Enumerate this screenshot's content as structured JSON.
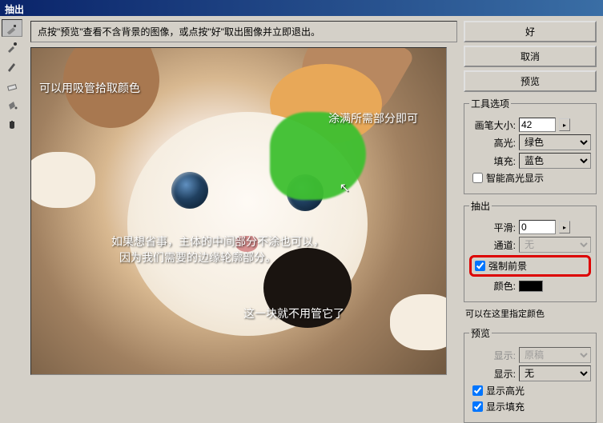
{
  "window": {
    "title": "抽出"
  },
  "hint": "点按\"预览\"查看不含背景的图像，或点按\"好\"取出图像并立即退出。",
  "overlay": {
    "text1": "可以用吸管拾取颜色",
    "text2": "涂满所需部分即可",
    "text3_line1": "如果想省事，主体的中间部分不涂也可以，",
    "text3_line2": "因为我们需要的边缘轮廓部分。",
    "text4": "这一块就不用管它了"
  },
  "buttons": {
    "ok": "好",
    "cancel": "取消",
    "preview": "预览"
  },
  "tool_options": {
    "legend": "工具选项",
    "brush_size_label": "画笔大小:",
    "brush_size_value": "42",
    "highlight_label": "高光:",
    "highlight_value": "绿色",
    "fill_label": "填充:",
    "fill_value": "蓝色",
    "smart_highlight": "智能高光显示"
  },
  "extract": {
    "legend": "抽出",
    "smooth_label": "平滑:",
    "smooth_value": "0",
    "channel_label": "通道:",
    "channel_value": "无",
    "force_fg": "强制前景",
    "color_label": "颜色:"
  },
  "color_note": "可以在这里指定颜色",
  "preview_group": {
    "legend": "预览",
    "show_label": "显示:",
    "show_value": "原稿",
    "display_label": "显示:",
    "display_value": "无",
    "show_highlight": "显示高光",
    "show_fill": "显示填充"
  },
  "tools": {
    "highlighter": "highlighter-tool",
    "eyedropper": "eyedropper-tool",
    "brush": "brush-tool",
    "eraser": "eraser-tool",
    "fill": "fill-tool",
    "hand": "hand-tool"
  }
}
